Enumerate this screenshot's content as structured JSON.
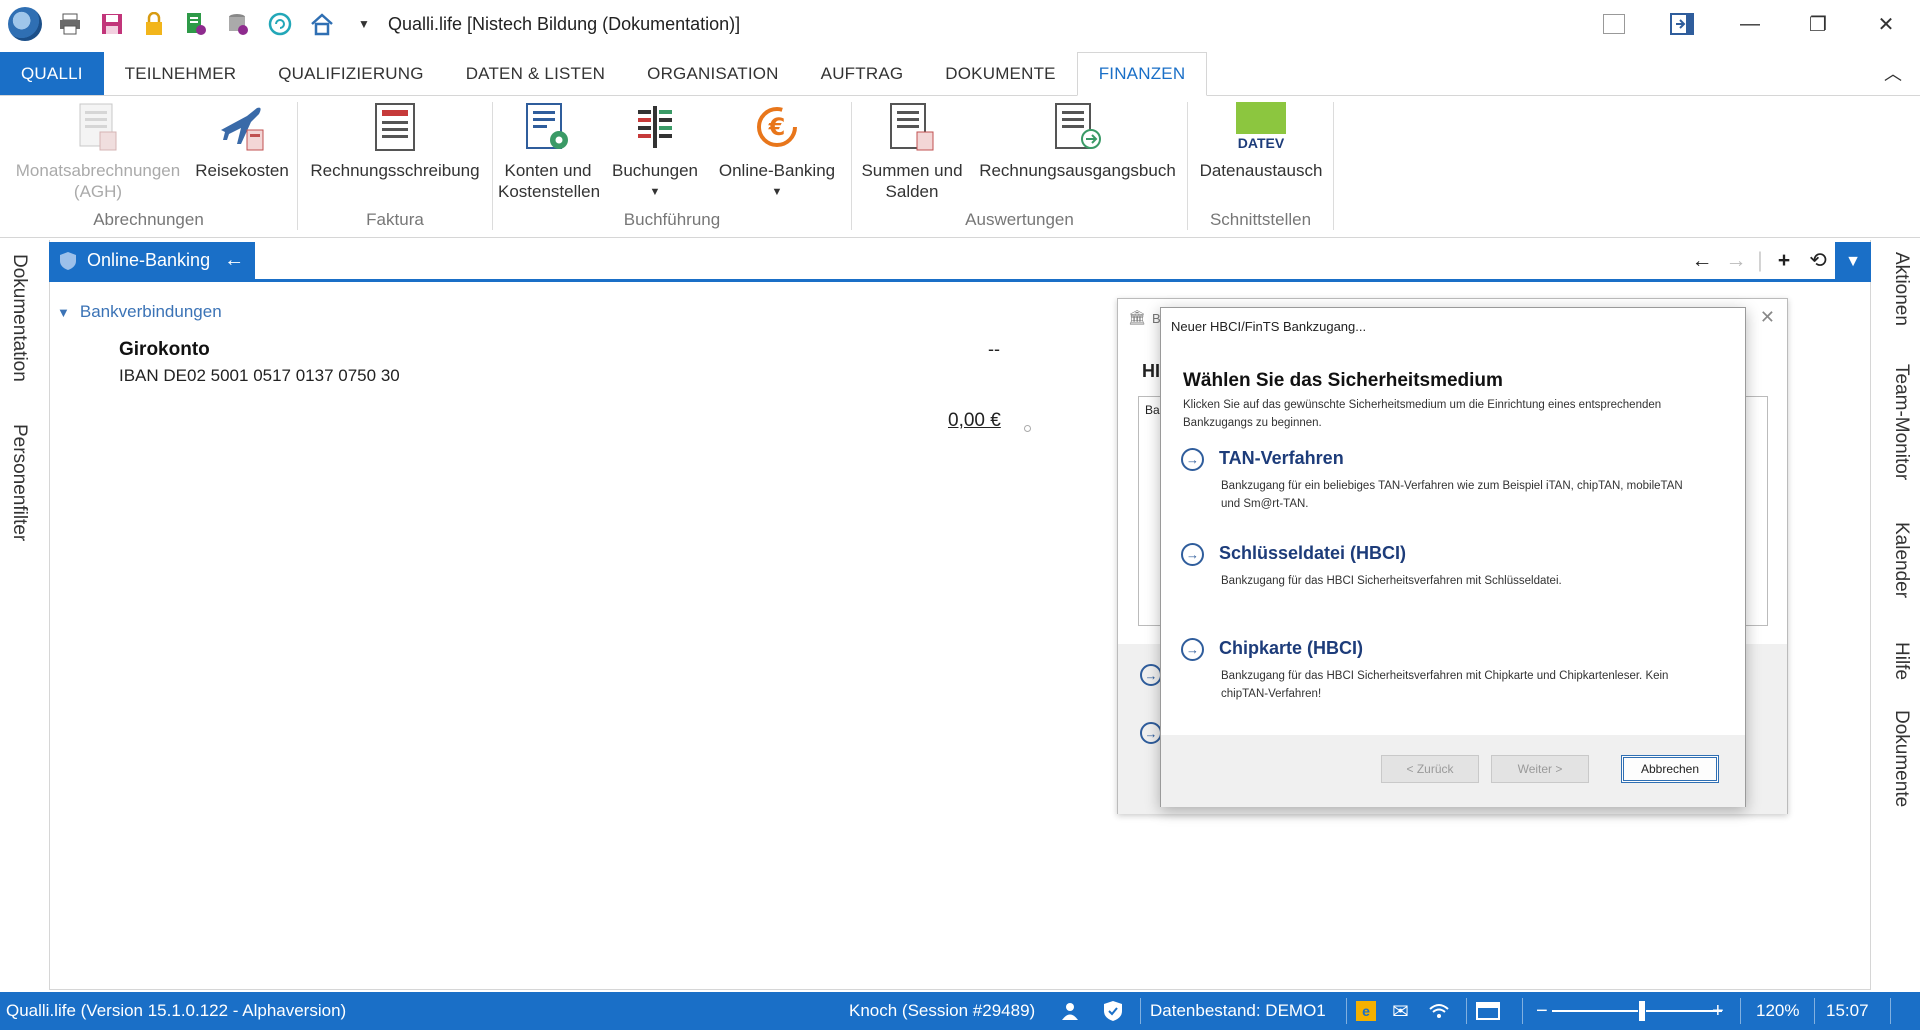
{
  "window": {
    "title": "Qualli.life [Nistech Bildung (Dokumentation)]",
    "controls": [
      "minimize",
      "maximize",
      "close"
    ]
  },
  "quick_access": [
    "print-icon",
    "save-icon",
    "lock-icon",
    "report-icon",
    "database-icon",
    "refresh-icon",
    "home-icon",
    "dropdown-icon"
  ],
  "tabs": [
    {
      "label": "QUALLI"
    },
    {
      "label": "TEILNEHMER"
    },
    {
      "label": "QUALIFIZIERUNG"
    },
    {
      "label": "DATEN & LISTEN"
    },
    {
      "label": "ORGANISATION"
    },
    {
      "label": "AUFTRAG"
    },
    {
      "label": "DOKUMENTE"
    },
    {
      "label": "FINANZEN"
    }
  ],
  "ribbon": {
    "groups": [
      {
        "title": "Abrechnungen",
        "buttons": [
          {
            "label": "Monatsabrechnungen",
            "label2": "(AGH)"
          },
          {
            "label": "Reisekosten"
          }
        ]
      },
      {
        "title": "Faktura",
        "buttons": [
          {
            "label": "Rechnungsschreibung"
          }
        ]
      },
      {
        "title": "Buchführung",
        "buttons": [
          {
            "label": "Konten und",
            "label2": "Kostenstellen"
          },
          {
            "label": "Buchungen"
          },
          {
            "label": "Online-Banking"
          }
        ]
      },
      {
        "title": "Auswertungen",
        "buttons": [
          {
            "label": "Summen und",
            "label2": "Salden"
          },
          {
            "label": "Rechnungsausgangsbuch"
          }
        ]
      },
      {
        "title": "Schnittstellen",
        "buttons": [
          {
            "label": "Datenaustausch",
            "logo_text": "DATEV"
          }
        ]
      }
    ]
  },
  "left_sidebar": [
    "Dokumentation",
    "Personenfilter"
  ],
  "right_sidebar": [
    "Aktionen",
    "Team-Monitor",
    "Kalender",
    "Hilfe",
    "Dokumente"
  ],
  "document_tab": {
    "label": "Online-Banking"
  },
  "bank": {
    "section_label": "Bankverbindungen",
    "account_name": "Girokonto",
    "iban": "IBAN DE02 5001 0517 0137 0750 30",
    "status": "--",
    "balance": "0,00 €"
  },
  "bg_dialog": {
    "title_fragment": "B",
    "heading_fragment": "HI",
    "box_fragment": "Ba"
  },
  "dialog": {
    "title": "Neuer HBCI/FinTS Bankzugang...",
    "heading": "Wählen Sie das Sicherheitsmedium",
    "description": "Klicken Sie auf das gewünschte Sicherheitsmedium um die Einrichtung eines entsprechenden Bankzugangs zu beginnen.",
    "options": [
      {
        "title": "TAN-Verfahren",
        "description": "Bankzugang für ein beliebiges TAN-Verfahren wie zum Beispiel iTAN, chipTAN, mobileTAN und Sm@rt-TAN."
      },
      {
        "title": "Schlüsseldatei (HBCI)",
        "description": "Bankzugang für das HBCI Sicherheitsverfahren mit Schlüsseldatei."
      },
      {
        "title": "Chipkarte (HBCI)",
        "description": "Bankzugang für das HBCI Sicherheitsverfahren mit Chipkarte und Chipkartenleser. Kein chipTAN-Verfahren!"
      }
    ],
    "buttons": {
      "back": "< Zurück",
      "next": "Weiter >",
      "cancel": "Abbrechen"
    }
  },
  "statusbar": {
    "version": "Qualli.life (Version 15.1.0.122 - Alphaversion)",
    "session": "Knoch (Session #29489)",
    "datastore": "Datenbestand: DEMO1",
    "zoom": "120%",
    "time": "15:07",
    "zoom_level": 0.53
  },
  "colors": {
    "accent": "#1a6fc7",
    "link": "#3b73b6",
    "option_title": "#1d3c7a",
    "datev_green": "#8cc63f"
  }
}
